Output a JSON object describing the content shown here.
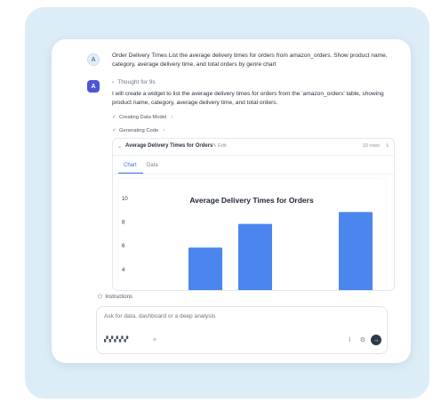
{
  "conversation": {
    "user_avatar": "A",
    "user_message": "Order Delivery Times List the average delivery times for orders from amazon_orders. Show product name, category, average delivery time, and total orders by genre chart",
    "ai_avatar": "A",
    "thought_label": "Thought for 9s",
    "ai_message": "I will create a widget to list the average delivery times for orders from the 'amazon_orders' table, showing product name, category, average delivery time, and total orders.",
    "steps": [
      {
        "label": "Creating Data Model"
      },
      {
        "label": "Generating Code"
      }
    ]
  },
  "widget": {
    "title": "Average Delivery Times for Orders",
    "edit_label": "Edit",
    "rows_label": "10 rows",
    "tabs": [
      "Chart",
      "Data"
    ],
    "active_tab": "Chart"
  },
  "chart_data": {
    "type": "bar",
    "title": "Average Delivery Times for Orders",
    "values": [
      6,
      8,
      0.4,
      9
    ],
    "y_ticks": [
      "10",
      "8",
      "6",
      "4"
    ],
    "ylim": [
      3,
      10
    ],
    "bar_color": "#4a86ee"
  },
  "instructions_label": "Instructions",
  "input": {
    "placeholder": "Ask for data, dashboard or a deep analysis"
  },
  "icons": {
    "thought_chevron": "chevron-right-icon",
    "check": "check-icon",
    "attach": "paperclip-icon",
    "settings": "gear-icon",
    "send": "arrow-right-icon"
  },
  "colors": {
    "accent": "#3b6fe0",
    "ai_avatar_bg": "#4b55d6",
    "background": "#dcedf7"
  }
}
